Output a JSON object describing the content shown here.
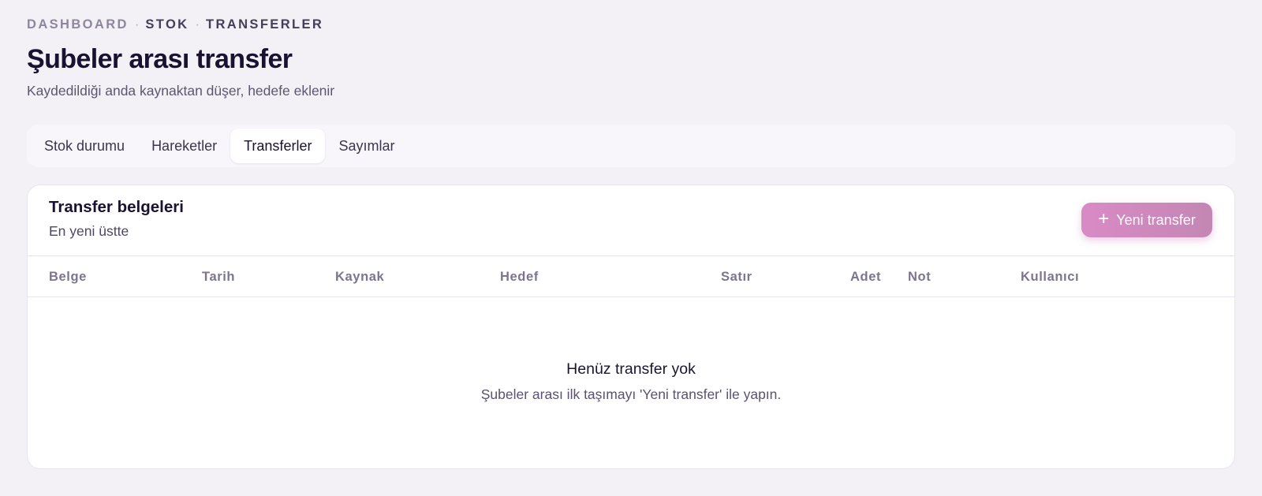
{
  "breadcrumb": {
    "items": [
      "DASHBOARD",
      "STOK",
      "TRANSFERLER"
    ],
    "separator": "·"
  },
  "page": {
    "title": "Şubeler arası transfer",
    "subtitle": "Kaydedildiği anda kaynaktan düşer, hedefe eklenir"
  },
  "tabs": [
    {
      "label": "Stok durumu",
      "active": false
    },
    {
      "label": "Hareketler",
      "active": false
    },
    {
      "label": "Transferler",
      "active": true
    },
    {
      "label": "Sayımlar",
      "active": false
    }
  ],
  "card": {
    "title": "Transfer belgeleri",
    "subtitle": "En yeni üstte",
    "new_button": {
      "label": "Yeni transfer",
      "icon": "plus-icon"
    }
  },
  "table": {
    "columns": [
      "Belge",
      "Tarih",
      "Kaynak",
      "Hedef",
      "Satır",
      "Adet",
      "Not",
      "Kullanıcı"
    ],
    "rows": []
  },
  "empty_state": {
    "title": "Henüz transfer yok",
    "subtitle": "Şubeler arası ilk taşımayı 'Yeni transfer' ile yapın."
  },
  "colors": {
    "background": "#f3f0f6",
    "accent_gradient_start": "#d98ac5",
    "accent_gradient_end": "#c387b4",
    "text_primary": "#1a1230",
    "text_muted": "#7d7590"
  }
}
